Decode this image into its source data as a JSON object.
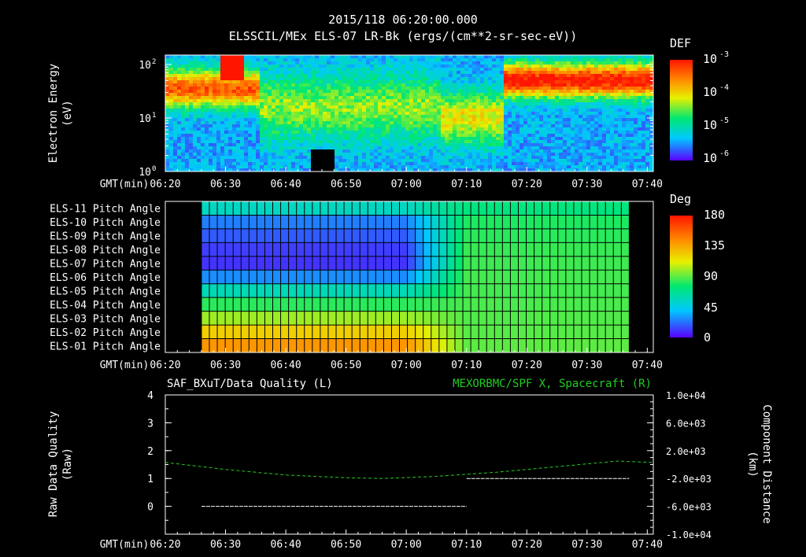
{
  "header": {
    "line1": "2015/118 06:20:00.000",
    "line2": "ELSSCIL/MEx ELS-07 LR-Bk  (ergs/(cm**2-sr-sec-eV))"
  },
  "time_axis": {
    "label": "GMT(min)",
    "ticks": [
      "06:20",
      "06:30",
      "06:40",
      "06:50",
      "07:00",
      "07:10",
      "07:20",
      "07:30",
      "07:40"
    ],
    "tick_minutes": [
      0,
      10,
      20,
      30,
      40,
      50,
      60,
      70,
      80
    ],
    "range_minutes": [
      0,
      81
    ]
  },
  "colors": {
    "background": "#000000",
    "foreground": "#ffffff",
    "spacecraft_series": "#22cc22",
    "quality_series": "#ffffff"
  },
  "chart_data": [
    {
      "type": "heatmap",
      "id": "spectrogram",
      "ylabel_line1": "Electron Energy",
      "ylabel_line2": "(eV)",
      "yscale": "log",
      "ylim": [
        1,
        150
      ],
      "ytick_values": [
        1,
        10,
        100
      ],
      "ytick_labels": [
        "10",
        "10",
        "10"
      ],
      "ytick_exponents": [
        "0",
        "1",
        "2"
      ],
      "colorbar": {
        "title": "DEF",
        "labels": [
          "10",
          "10",
          "10",
          "10"
        ],
        "exponents": [
          "-3",
          "-4",
          "-5",
          "-6"
        ]
      }
    },
    {
      "type": "heatmap",
      "id": "pitch-angle",
      "rows": [
        "ELS-11 Pitch Angle",
        "ELS-10 Pitch Angle",
        "ELS-09 Pitch Angle",
        "ELS-08 Pitch Angle",
        "ELS-07 Pitch Angle",
        "ELS-06 Pitch Angle",
        "ELS-05 Pitch Angle",
        "ELS-04 Pitch Angle",
        "ELS-03 Pitch Angle",
        "ELS-02 Pitch Angle",
        "ELS-01 Pitch Angle"
      ],
      "x_start_minutes": 6,
      "x_end_minutes": 77,
      "columns": 54,
      "row_values_early": [
        55,
        25,
        18,
        12,
        10,
        28,
        58,
        82,
        100,
        122,
        140
      ],
      "row_values_late": [
        72,
        80,
        82,
        84,
        85,
        86,
        86,
        87,
        88,
        89,
        90
      ],
      "transition_minutes": [
        40,
        50
      ],
      "colorbar": {
        "title": "Deg",
        "labels": [
          "180",
          "135",
          "90",
          "45",
          "0"
        ],
        "range": [
          0,
          180
        ]
      }
    },
    {
      "type": "line",
      "id": "quality",
      "title_left": "SAF_BXuT/Data Quality (L)",
      "title_right": "MEXORBMC/SPF X, Spacecraft (R)",
      "ylabel_left_line1": "Raw Data Quality",
      "ylabel_left_line2": "(Raw)",
      "ylabel_right_line1": "Component Distance",
      "ylabel_right_line2": "(km)",
      "ylim_left": [
        -1,
        4
      ],
      "yticks_left": [
        "4",
        "3",
        "2",
        "1",
        "0"
      ],
      "ytick_values_left": [
        4,
        3,
        2,
        1,
        0
      ],
      "ylim_right": [
        -10000,
        10000
      ],
      "yticks_right": [
        "1.0e+04",
        "6.0e+03",
        "2.0e+03",
        "-2.0e+03",
        "-6.0e+03",
        "-1.0e+04"
      ],
      "ytick_values_right": [
        10000,
        6000,
        2000,
        -2000,
        -6000,
        -10000
      ],
      "series": [
        {
          "axis": "left",
          "segments": [
            {
              "x": [
                6,
                50
              ],
              "y": [
                0,
                0
              ]
            },
            {
              "x": [
                50,
                77
              ],
              "y": [
                1,
                1
              ]
            }
          ]
        },
        {
          "axis": "right",
          "x": [
            0,
            10,
            20,
            30,
            36,
            45,
            55,
            65,
            75,
            81
          ],
          "y": [
            300,
            -700,
            -1500,
            -1900,
            -2000,
            -1700,
            -1100,
            -300,
            500,
            300
          ]
        }
      ]
    }
  ]
}
